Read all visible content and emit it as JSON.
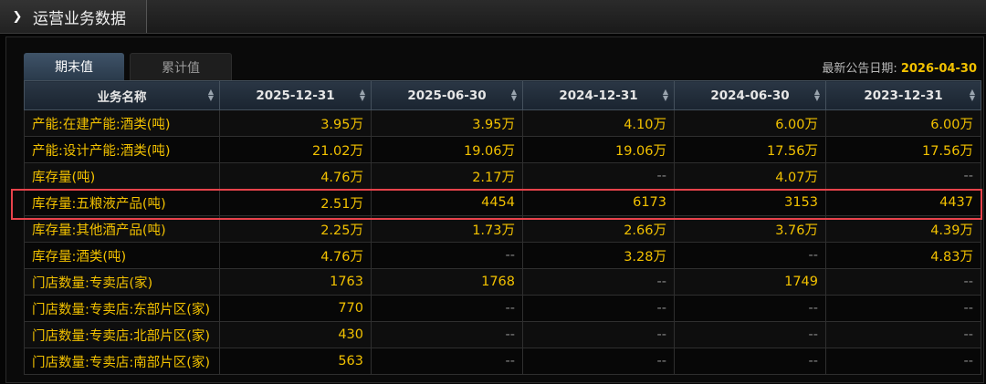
{
  "header": {
    "title": "运营业务数据",
    "arrow_icon": "chevron-right-icon"
  },
  "tabs": [
    {
      "label": "期末值",
      "active": true
    },
    {
      "label": "累计值",
      "active": false
    }
  ],
  "announcement": {
    "label": "最新公告日期:",
    "date": "2026-04-30"
  },
  "table": {
    "columns": [
      "业务名称",
      "2025-12-31",
      "2025-06-30",
      "2024-12-31",
      "2024-06-30",
      "2023-12-31"
    ],
    "rows": [
      [
        "产能:在建产能:酒类(吨)",
        "3.95万",
        "3.95万",
        "4.10万",
        "6.00万",
        "6.00万"
      ],
      [
        "产能:设计产能:酒类(吨)",
        "21.02万",
        "19.06万",
        "19.06万",
        "17.56万",
        "17.56万"
      ],
      [
        "库存量(吨)",
        "4.76万",
        "2.17万",
        "--",
        "4.07万",
        "--"
      ],
      [
        "库存量:五粮液产品(吨)",
        "2.51万",
        "4454",
        "6173",
        "3153",
        "4437"
      ],
      [
        "库存量:其他酒产品(吨)",
        "2.25万",
        "1.73万",
        "2.66万",
        "3.76万",
        "4.39万"
      ],
      [
        "库存量:酒类(吨)",
        "4.76万",
        "--",
        "3.28万",
        "--",
        "4.83万"
      ],
      [
        "门店数量:专卖店(家)",
        "1763",
        "1768",
        "--",
        "1749",
        "--"
      ],
      [
        "门店数量:专卖店:东部片区(家)",
        "770",
        "--",
        "--",
        "--",
        "--"
      ],
      [
        "门店数量:专卖店:北部片区(家)",
        "430",
        "--",
        "--",
        "--",
        "--"
      ],
      [
        "门店数量:专卖店:南部片区(家)",
        "563",
        "--",
        "--",
        "--",
        "--"
      ]
    ]
  },
  "colors": {
    "accent_yellow": "#f2c100",
    "highlight_red": "#e8434b",
    "header_blue": "#2a3644"
  }
}
